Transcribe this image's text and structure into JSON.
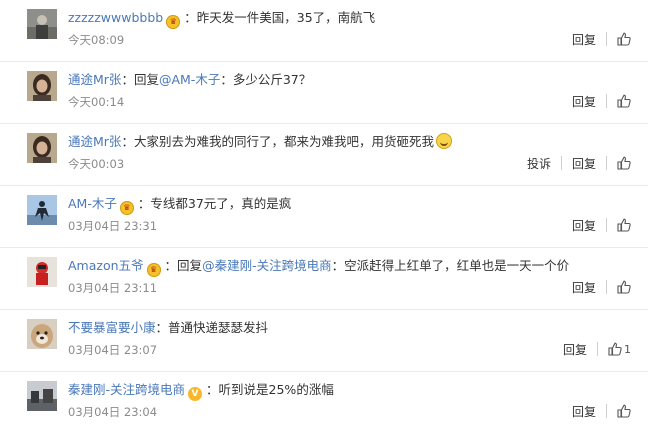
{
  "comments": [
    {
      "user": "zzzzzwwwbbbb",
      "badge": "vip",
      "mention": "",
      "sep": "：",
      "text": "昨天发一件美国，35了，南航飞",
      "time": "今天08:09",
      "report": "",
      "reply": "回复",
      "likes": "",
      "emoji": false
    },
    {
      "user": "通途Mr张",
      "badge": "",
      "mention": "@AM-木子",
      "sep": "：",
      "prefix": "回复",
      "text": "多少公斤37？",
      "time": "今天00:14",
      "report": "",
      "reply": "回复",
      "likes": "",
      "emoji": false
    },
    {
      "user": "通途Mr张",
      "badge": "",
      "mention": "",
      "sep": "：",
      "text": "大家别去为难我的同行了，都来为难我吧，用货砸死我",
      "time": "今天00:03",
      "report": "投诉",
      "reply": "回复",
      "likes": "",
      "emoji": true
    },
    {
      "user": "AM-木子",
      "badge": "vip",
      "mention": "",
      "sep": "：",
      "text": "专线都37元了，真的是疯",
      "time": "03月04日 23:31",
      "report": "",
      "reply": "回复",
      "likes": "",
      "emoji": false
    },
    {
      "user": "Amazon五爷",
      "badge": "vip",
      "mention": "@秦建刚-关注跨境电商",
      "sep": "：",
      "prefix": "回复",
      "text": "空派赶得上红单了，红单也是一天一个价",
      "time": "03月04日 23:11",
      "report": "",
      "reply": "回复",
      "likes": "",
      "emoji": false
    },
    {
      "user": "不要暴富要小康",
      "badge": "",
      "mention": "",
      "sep": "：",
      "text": "普通快递瑟瑟发抖",
      "time": "03月04日 23:07",
      "report": "",
      "reply": "回复",
      "likes": "1",
      "emoji": false
    },
    {
      "user": "秦建刚-关注跨境电商",
      "badge": "v",
      "mention": "",
      "sep": "：",
      "text": "听到说是25%的涨幅",
      "time": "03月04日 23:04",
      "report": "",
      "reply": "回复",
      "likes": "",
      "emoji": false
    }
  ],
  "colors": {
    "link": "#4a78b8",
    "meta": "#8b8b8b",
    "text": "#333333"
  }
}
